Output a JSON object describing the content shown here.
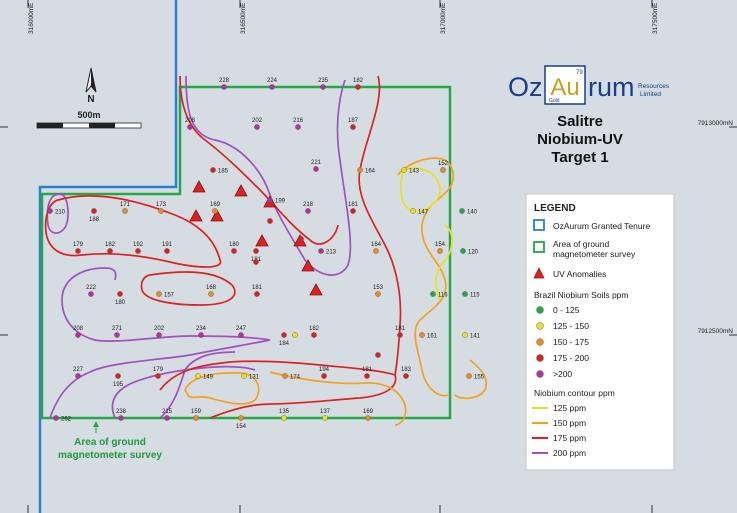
{
  "coords": {
    "easting": [
      "316000mE",
      "316500mE",
      "317000mE",
      "317500mE"
    ],
    "northing": [
      "7913000mN",
      "7912500mN"
    ]
  },
  "north_arrow": {
    "label": "N"
  },
  "scale_bar": {
    "label": "500m"
  },
  "logo": {
    "oz": "Oz",
    "au": "Au",
    "au_number": "79",
    "au_name": "Gold",
    "rum": "rum",
    "resources": "Resources",
    "limited": "Limited"
  },
  "title": {
    "line1": "Salitre",
    "line2": "Niobium-UV",
    "line3": "Target 1"
  },
  "survey_label": {
    "line1": "Area of ground",
    "line2": "magnetometer survey"
  },
  "legend": {
    "title": "LEGEND",
    "tenure": "OzAurum Granted Tenure",
    "survey_line1": "Area of ground",
    "survey_line2": "magnetometer survey",
    "uv": "UV Anomalies",
    "soils_title": "Brazil Niobium Soils ppm",
    "soil_classes": [
      {
        "label": "0 - 125",
        "color": "#22a845"
      },
      {
        "label": "125 - 150",
        "color": "#e8e020"
      },
      {
        "label": "150 - 175",
        "color": "#f08a1c"
      },
      {
        "label": "175 - 200",
        "color": "#e02020"
      },
      {
        "label": ">200",
        "color": "#b82fa0"
      }
    ],
    "contour_title": "Niobium contour ppm",
    "contours": [
      {
        "label": "125 ppm",
        "color": "#e8e020"
      },
      {
        "label": "150 ppm",
        "color": "#f5a020"
      },
      {
        "label": "175 ppm",
        "color": "#e02020"
      },
      {
        "label": "200 ppm",
        "color": "#a050c0"
      }
    ]
  },
  "samples": [
    {
      "value": "228",
      "cls": 4
    },
    {
      "value": "224",
      "cls": 4
    },
    {
      "value": "235",
      "cls": 4
    },
    {
      "value": "182",
      "cls": 3
    },
    {
      "value": "208",
      "cls": 4
    },
    {
      "value": "202",
      "cls": 4
    },
    {
      "value": "216",
      "cls": 4
    },
    {
      "value": "187",
      "cls": 3
    },
    {
      "value": "221",
      "cls": 4
    },
    {
      "value": "185",
      "cls": 3
    },
    {
      "value": "164",
      "cls": 2
    },
    {
      "value": "152",
      "cls": 2
    },
    {
      "value": "143",
      "cls": 1
    },
    {
      "value": "199",
      "cls": 4
    },
    {
      "value": "210",
      "cls": 4
    },
    {
      "value": "188",
      "cls": 3
    },
    {
      "value": "171",
      "cls": 2
    },
    {
      "value": "173",
      "cls": 2
    },
    {
      "value": "169",
      "cls": 2
    },
    {
      "value": "218",
      "cls": 4
    },
    {
      "value": "181",
      "cls": 3
    },
    {
      "value": "147",
      "cls": 1
    },
    {
      "value": "140",
      "cls": 0
    },
    {
      "value": "179",
      "cls": 3
    },
    {
      "value": "182",
      "cls": 3
    },
    {
      "value": "192",
      "cls": 3
    },
    {
      "value": "191",
      "cls": 3
    },
    {
      "value": "180",
      "cls": 3
    },
    {
      "value": "181",
      "cls": 3
    },
    {
      "value": "213",
      "cls": 4
    },
    {
      "value": "164",
      "cls": 2
    },
    {
      "value": "154",
      "cls": 2
    },
    {
      "value": "120",
      "cls": 0
    },
    {
      "value": "222",
      "cls": 4
    },
    {
      "value": "180",
      "cls": 3
    },
    {
      "value": "157",
      "cls": 2
    },
    {
      "value": "168",
      "cls": 2
    },
    {
      "value": "181",
      "cls": 3
    },
    {
      "value": "153",
      "cls": 2
    },
    {
      "value": "116",
      "cls": 0
    },
    {
      "value": "115",
      "cls": 0
    },
    {
      "value": "208",
      "cls": 4
    },
    {
      "value": "271",
      "cls": 4
    },
    {
      "value": "202",
      "cls": 4
    },
    {
      "value": "234",
      "cls": 4
    },
    {
      "value": "247",
      "cls": 4
    },
    {
      "value": "184",
      "cls": 3
    },
    {
      "value": "182",
      "cls": 3
    },
    {
      "value": "181",
      "cls": 3
    },
    {
      "value": "161",
      "cls": 2
    },
    {
      "value": "141",
      "cls": 1
    },
    {
      "value": "227",
      "cls": 4
    },
    {
      "value": "195",
      "cls": 3
    },
    {
      "value": "179",
      "cls": 3
    },
    {
      "value": "149",
      "cls": 1
    },
    {
      "value": "131",
      "cls": 1
    },
    {
      "value": "174",
      "cls": 2
    },
    {
      "value": "194",
      "cls": 3
    },
    {
      "value": "181",
      "cls": 3
    },
    {
      "value": "183",
      "cls": 3
    },
    {
      "value": "155",
      "cls": 2
    },
    {
      "value": "262",
      "cls": 4
    },
    {
      "value": "238",
      "cls": 4
    },
    {
      "value": "215",
      "cls": 4
    },
    {
      "value": "159",
      "cls": 2
    },
    {
      "value": "154",
      "cls": 2
    },
    {
      "value": "135",
      "cls": 1
    },
    {
      "value": "137",
      "cls": 1
    },
    {
      "value": "169",
      "cls": 2
    }
  ],
  "unlabelled_samples": [
    {
      "cls": 3
    },
    {
      "cls": 3
    },
    {
      "cls": 3
    },
    {
      "cls": 3
    },
    {
      "cls": 1
    }
  ],
  "uv_anomaly_count": 9
}
